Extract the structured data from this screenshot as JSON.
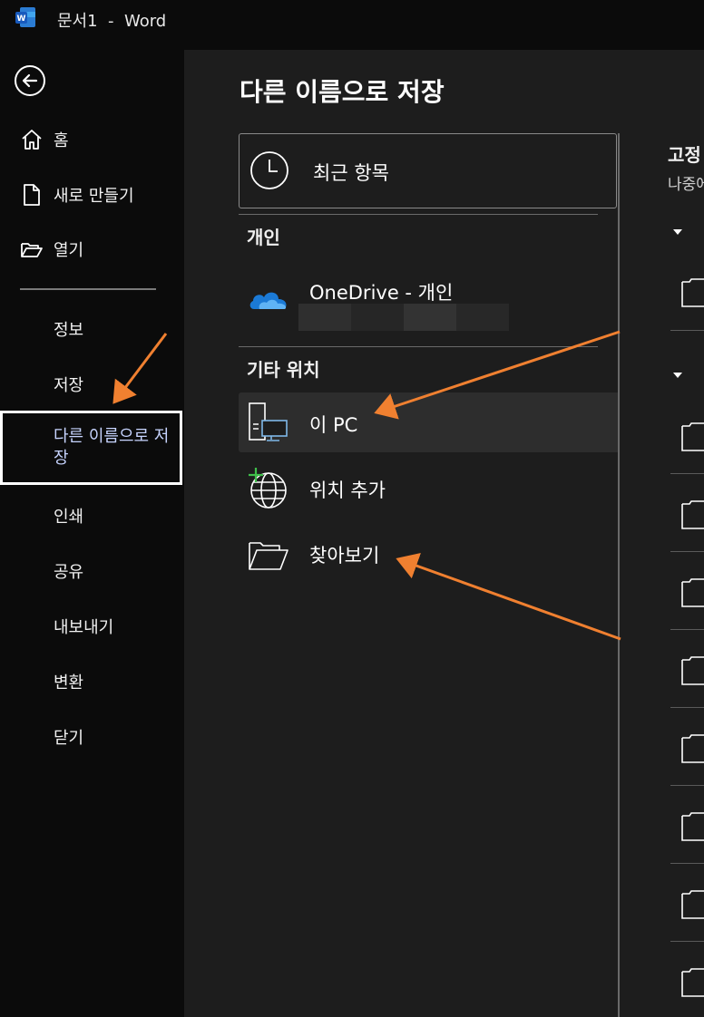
{
  "window": {
    "title": "문서1  -  Word",
    "app_icon": "word-app-icon"
  },
  "sidebar": {
    "back_icon": "back-arrow-icon",
    "top_items": [
      {
        "label": "홈",
        "icon": "home-icon"
      },
      {
        "label": "새로 만들기",
        "icon": "new-document-icon"
      },
      {
        "label": "열기",
        "icon": "open-folder-icon"
      }
    ],
    "items": [
      {
        "label": "정보"
      },
      {
        "label": "저장"
      },
      {
        "label": "다른 이름으로 저장",
        "active": true
      },
      {
        "label": "인쇄"
      },
      {
        "label": "공유"
      },
      {
        "label": "내보내기"
      },
      {
        "label": "변환"
      },
      {
        "label": "닫기"
      }
    ]
  },
  "main": {
    "title": "다른 이름으로 저장",
    "recent": {
      "label": "최근 항목",
      "icon": "clock-icon"
    },
    "personal_header": "개인",
    "onedrive": {
      "label": "OneDrive - 개인",
      "icon": "onedrive-cloud-icon",
      "account_redacted": true
    },
    "other_header": "기타 위치",
    "locations": [
      {
        "label": "이 PC",
        "icon": "this-pc-icon",
        "selected": true
      },
      {
        "label": "위치 추가",
        "icon": "add-place-globe-icon"
      },
      {
        "label": "찾아보기",
        "icon": "browse-folder-icon"
      }
    ]
  },
  "right_panel": {
    "title_partial": "고정",
    "subtitle_partial": "나중에",
    "folder_icon": "folder-icon"
  },
  "annotations": {
    "arrow_color": "#f08030"
  },
  "colors": {
    "background": "#0b0b0b",
    "panel": "#1d1d1d",
    "selected": "#2d2d2d",
    "active_text": "#c7d4ff"
  }
}
